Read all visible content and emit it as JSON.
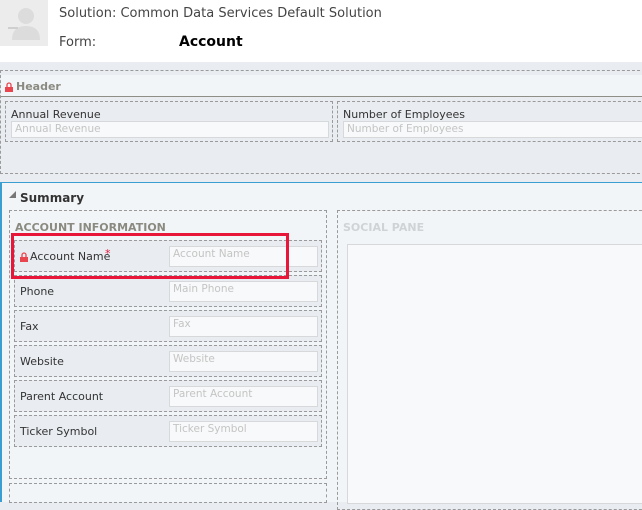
{
  "header": {
    "solution_label": "Solution: Common Data Services Default Solution",
    "form_label": "Form:",
    "form_name": "Account"
  },
  "header_section": {
    "title": "Header",
    "fields": [
      {
        "label": "Annual Revenue",
        "placeholder": "Annual Revenue"
      },
      {
        "label": "Number of Employees",
        "placeholder": "Number of Employees"
      }
    ]
  },
  "summary": {
    "title": "Summary",
    "account_info_title": "ACCOUNT INFORMATION",
    "social_pane_title": "SOCIAL PANE",
    "fields": [
      {
        "label": "Account Name",
        "placeholder": "Account Name",
        "required": "*"
      },
      {
        "label": "Phone",
        "placeholder": "Main Phone"
      },
      {
        "label": "Fax",
        "placeholder": "Fax"
      },
      {
        "label": "Website",
        "placeholder": "Website"
      },
      {
        "label": "Parent Account",
        "placeholder": "Parent Account"
      },
      {
        "label": "Ticker Symbol",
        "placeholder": "Ticker Symbol"
      }
    ]
  },
  "colors": {
    "highlight": "#e8173a",
    "accent": "#3a9fd0",
    "lock": "#e8454f"
  }
}
